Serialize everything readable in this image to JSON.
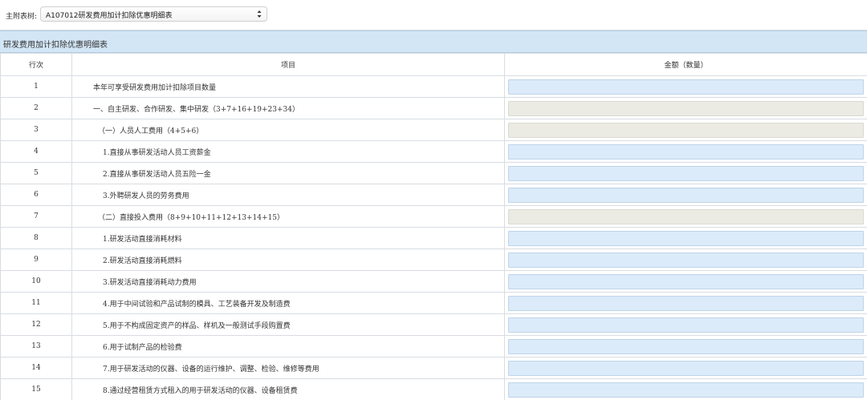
{
  "toolbar": {
    "label": "主附表树:",
    "select_value": "A107012研发费用加计扣除优惠明细表"
  },
  "section": {
    "title": "研发费用加计扣除优惠明细表"
  },
  "table": {
    "headers": [
      "行次",
      "项目",
      "金额（数量）"
    ],
    "rows": [
      {
        "no": "1",
        "item": "本年可享受研发费用加计扣除项目数量",
        "indent": 0,
        "editable": true
      },
      {
        "no": "2",
        "item": "一、自主研发、合作研发、集中研发（3+7+16+19+23+34）",
        "indent": 0,
        "editable": false
      },
      {
        "no": "3",
        "item": "（一）人员人工费用（4+5+6）",
        "indent": 1,
        "editable": false
      },
      {
        "no": "4",
        "item": "1.直接从事研发活动人员工资薪金",
        "indent": 2,
        "editable": true
      },
      {
        "no": "5",
        "item": "2.直接从事研发活动人员五险一金",
        "indent": 2,
        "editable": true
      },
      {
        "no": "6",
        "item": "3.外聘研发人员的劳务费用",
        "indent": 2,
        "editable": true
      },
      {
        "no": "7",
        "item": "（二）直接投入费用（8+9+10+11+12+13+14+15）",
        "indent": 1,
        "editable": false
      },
      {
        "no": "8",
        "item": "1.研发活动直接消耗材料",
        "indent": 2,
        "editable": true
      },
      {
        "no": "9",
        "item": "2.研发活动直接消耗燃料",
        "indent": 2,
        "editable": true
      },
      {
        "no": "10",
        "item": "3.研发活动直接消耗动力费用",
        "indent": 2,
        "editable": true
      },
      {
        "no": "11",
        "item": "4.用于中间试验和产品试制的模具、工艺装备开发及制造费",
        "indent": 2,
        "editable": true
      },
      {
        "no": "12",
        "item": "5.用于不构成固定资产的样品、样机及一般测试手段购置费",
        "indent": 2,
        "editable": true
      },
      {
        "no": "13",
        "item": "6.用于试制产品的检验费",
        "indent": 2,
        "editable": true
      },
      {
        "no": "14",
        "item": "7.用于研发活动的仪器、设备的运行维护、调整、检验、维修等费用",
        "indent": 2,
        "editable": true
      },
      {
        "no": "15",
        "item": "8.通过经营租赁方式租入的用于研发活动的仪器、设备租赁费",
        "indent": 2,
        "editable": true
      }
    ]
  },
  "colors": {
    "section_bg": "#d3e6f6",
    "input_editable": "#dcebf9",
    "input_readonly": "#ebebe4",
    "grid_line": "#d8dde3"
  },
  "icons": {
    "select_arrow": "updown-chevron-icon"
  }
}
